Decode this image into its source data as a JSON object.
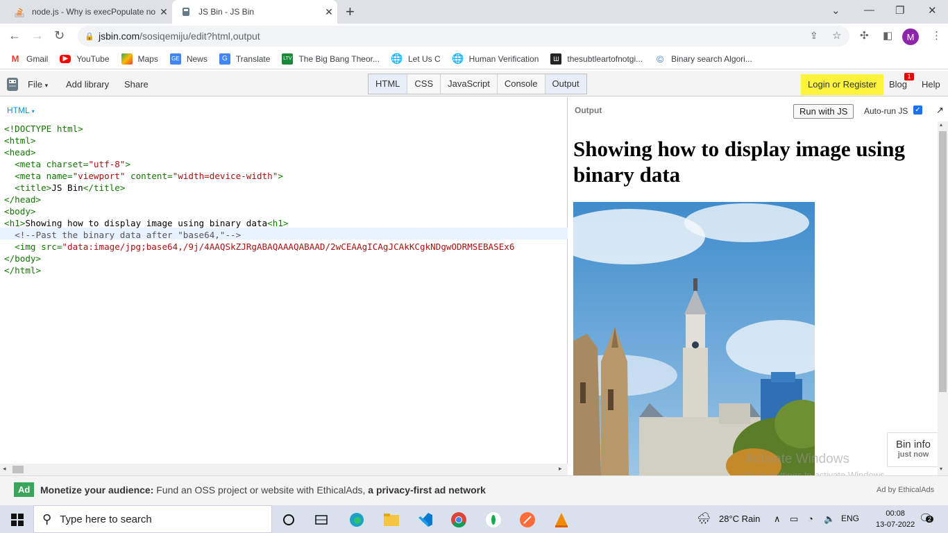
{
  "browser": {
    "tabs": [
      {
        "title": "node.js - Why is execPopulate no",
        "active": false
      },
      {
        "title": "JS Bin - JS Bin",
        "active": true
      }
    ],
    "url_host": "jsbin.com",
    "url_path": "/sosiqemiju/edit?html,output",
    "avatar_letter": "M",
    "bookmarks": [
      {
        "label": "Gmail",
        "icon": "gmail-icon"
      },
      {
        "label": "YouTube",
        "icon": "youtube-icon"
      },
      {
        "label": "Maps",
        "icon": "maps-icon"
      },
      {
        "label": "News",
        "icon": "news-icon"
      },
      {
        "label": "Translate",
        "icon": "translate-icon"
      },
      {
        "label": "The Big Bang Theor...",
        "icon": "ltv-icon"
      },
      {
        "label": "Let Us C",
        "icon": "globe-icon"
      },
      {
        "label": "Human Verification",
        "icon": "globe-icon"
      },
      {
        "label": "thesubtleartofnotgi...",
        "icon": "library-icon"
      },
      {
        "label": "Binary search Algori...",
        "icon": "bracket-icon"
      }
    ]
  },
  "jsbin": {
    "menu": {
      "file": "File",
      "add_library": "Add library",
      "share": "Share"
    },
    "panels": [
      "HTML",
      "CSS",
      "JavaScript",
      "Console",
      "Output"
    ],
    "login": "Login or Register",
    "blog": "Blog",
    "blog_badge": "1",
    "help": "Help"
  },
  "editor": {
    "label": "HTML",
    "lines": {
      "l1": "<!DOCTYPE html>",
      "l2": "<html>",
      "l3": "<head>",
      "l4a": "  <meta charset=",
      "l4b": "\"utf-8\"",
      "l4c": ">",
      "l5a": "  <meta name=",
      "l5b": "\"viewport\"",
      "l5c": " content=",
      "l5d": "\"width=device-width\"",
      "l5e": ">",
      "l6a": "  <title>",
      "l6b": "JS Bin",
      "l6c": "</title>",
      "l7": "</head>",
      "l8": "<body>",
      "l9a": "<h1>",
      "l9b": "Showing how to display image using binary data",
      "l9c": "<h1>",
      "l10": "  <!--Past the binary data after \"base64,\"-->",
      "l11a": "  <img src=",
      "l11b": "\"data:image/jpg;base64,/9j/4AAQSkZJRgABAQAAAQABAAD/2wCEAAgICAgJCAkKCgkNDgwODRMSEBASEx6",
      "l12": "</body>",
      "l13": "</html>"
    }
  },
  "output": {
    "label": "Output",
    "run_button": "Run with JS",
    "autorun_label": "Auto-run JS",
    "autorun_checked": true,
    "heading": "Showing how to display image using binary data",
    "bin_info_title": "Bin info",
    "bin_info_sub": "just now",
    "watermark_title": "Activate Windows",
    "watermark_sub": "Go to Settings to activate Windows."
  },
  "ad": {
    "tag": "Ad",
    "bold1": "Monetize your audience:",
    "text": " Fund an OSS project or website with EthicalAds, ",
    "bold2": "a privacy-first ad network",
    "by": "Ad by EthicalAds"
  },
  "taskbar": {
    "search_placeholder": "Type here to search",
    "weather": "28°C  Rain",
    "lang": "ENG",
    "time": "00:08",
    "date": "13-07-2022",
    "notif_count": "2"
  }
}
